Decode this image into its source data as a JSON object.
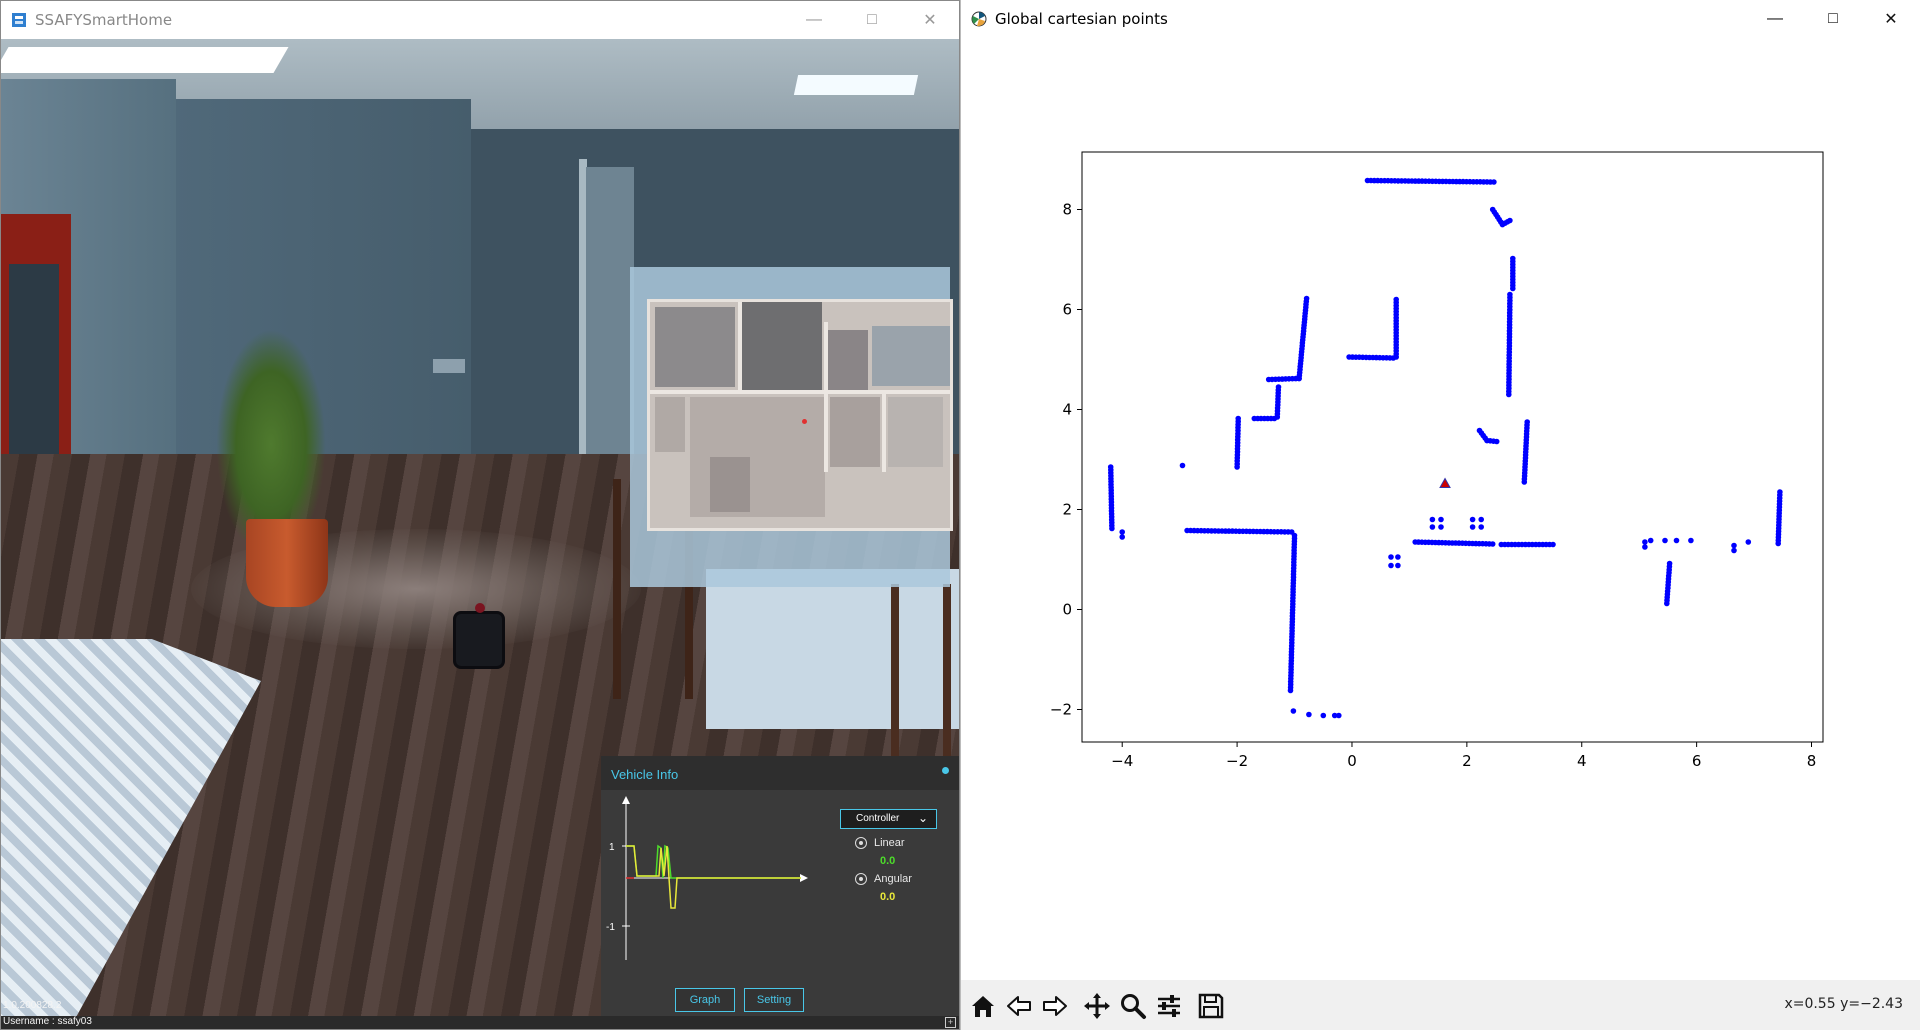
{
  "left_window": {
    "title": "SSAFYSmartHome",
    "version": "1.0.200828.2",
    "username": "Username : ssafy03",
    "vehicle_info": {
      "title": "Vehicle Info",
      "controller": "Controller",
      "linear_label": "Linear",
      "linear_value": "0.0",
      "angular_label": "Angular",
      "angular_value": "0.0",
      "graph_button": "Graph",
      "setting_button": "Setting",
      "graph_tick_pos": "1",
      "graph_tick_neg": "-1",
      "linear_color": "#4ddc2a",
      "angular_color": "#e8e83a"
    }
  },
  "right_window": {
    "title": "Global cartesian points",
    "status": "x=0.55 y=−2.43",
    "toolbar_icons": [
      "home-icon",
      "back-arrow-icon",
      "forward-arrow-icon",
      "pan-icon",
      "zoom-icon",
      "configure-subplots-icon",
      "save-icon"
    ]
  },
  "chart_data": {
    "type": "scatter",
    "title": "",
    "xlabel": "",
    "ylabel": "",
    "xlim": [
      -4.7,
      8.2
    ],
    "ylim": [
      -2.65,
      9.15
    ],
    "xticks": [
      "−4",
      "−2",
      "0",
      "2",
      "4",
      "6",
      "8"
    ],
    "yticks": [
      "−2",
      "0",
      "2",
      "4",
      "6",
      "8"
    ],
    "xtick_values": [
      -4,
      -2,
      0,
      2,
      4,
      6,
      8
    ],
    "ytick_values": [
      -2,
      0,
      2,
      4,
      6,
      8
    ],
    "grid": false,
    "point_color": "#0000ff",
    "robot_marker": {
      "x": 1.62,
      "y": 2.52,
      "color": "#cc0000"
    },
    "segments": [
      [
        0.27,
        8.58,
        2.47,
        8.55
      ],
      [
        2.45,
        8.0,
        2.62,
        7.7
      ],
      [
        2.62,
        7.7,
        2.75,
        7.78
      ],
      [
        2.8,
        7.02,
        2.8,
        6.42
      ],
      [
        2.75,
        6.3,
        2.73,
        4.3
      ],
      [
        -0.79,
        6.22,
        -0.92,
        4.62
      ],
      [
        -0.92,
        4.62,
        -1.45,
        4.6
      ],
      [
        -1.28,
        4.45,
        -1.3,
        3.85
      ],
      [
        -1.35,
        3.82,
        -1.7,
        3.82
      ],
      [
        -1.98,
        3.82,
        -2.0,
        2.85
      ],
      [
        -0.05,
        5.05,
        0.72,
        5.03
      ],
      [
        0.77,
        6.2,
        0.77,
        5.05
      ],
      [
        2.22,
        3.58,
        2.35,
        3.38
      ],
      [
        2.35,
        3.38,
        2.52,
        3.36
      ],
      [
        3.05,
        3.75,
        3.0,
        2.55
      ],
      [
        -4.2,
        2.85,
        -4.18,
        1.62
      ],
      [
        -2.87,
        1.58,
        -1.05,
        1.55
      ],
      [
        -1.0,
        1.48,
        -1.07,
        -1.62
      ],
      [
        1.1,
        1.35,
        2.45,
        1.31
      ],
      [
        2.6,
        1.3,
        3.5,
        1.3
      ],
      [
        5.53,
        0.92,
        5.48,
        0.12
      ],
      [
        7.45,
        2.35,
        7.42,
        1.32
      ]
    ],
    "points": [
      [
        -4.0,
        1.55
      ],
      [
        -4.0,
        1.45
      ],
      [
        -2.95,
        2.88
      ],
      [
        1.4,
        1.8
      ],
      [
        1.55,
        1.8
      ],
      [
        1.4,
        1.65
      ],
      [
        1.55,
        1.65
      ],
      [
        2.1,
        1.8
      ],
      [
        2.25,
        1.8
      ],
      [
        2.1,
        1.65
      ],
      [
        2.25,
        1.65
      ],
      [
        0.68,
        1.05
      ],
      [
        0.8,
        1.05
      ],
      [
        0.68,
        0.88
      ],
      [
        0.8,
        0.88
      ],
      [
        5.1,
        1.35
      ],
      [
        5.1,
        1.25
      ],
      [
        5.2,
        1.38
      ],
      [
        5.45,
        1.38
      ],
      [
        5.65,
        1.38
      ],
      [
        5.9,
        1.38
      ],
      [
        6.65,
        1.28
      ],
      [
        6.65,
        1.18
      ],
      [
        6.9,
        1.35
      ],
      [
        -1.02,
        -2.03
      ],
      [
        -0.75,
        -2.1
      ],
      [
        -0.5,
        -2.12
      ],
      [
        -0.3,
        -2.12
      ],
      [
        -0.23,
        -2.12
      ]
    ]
  }
}
